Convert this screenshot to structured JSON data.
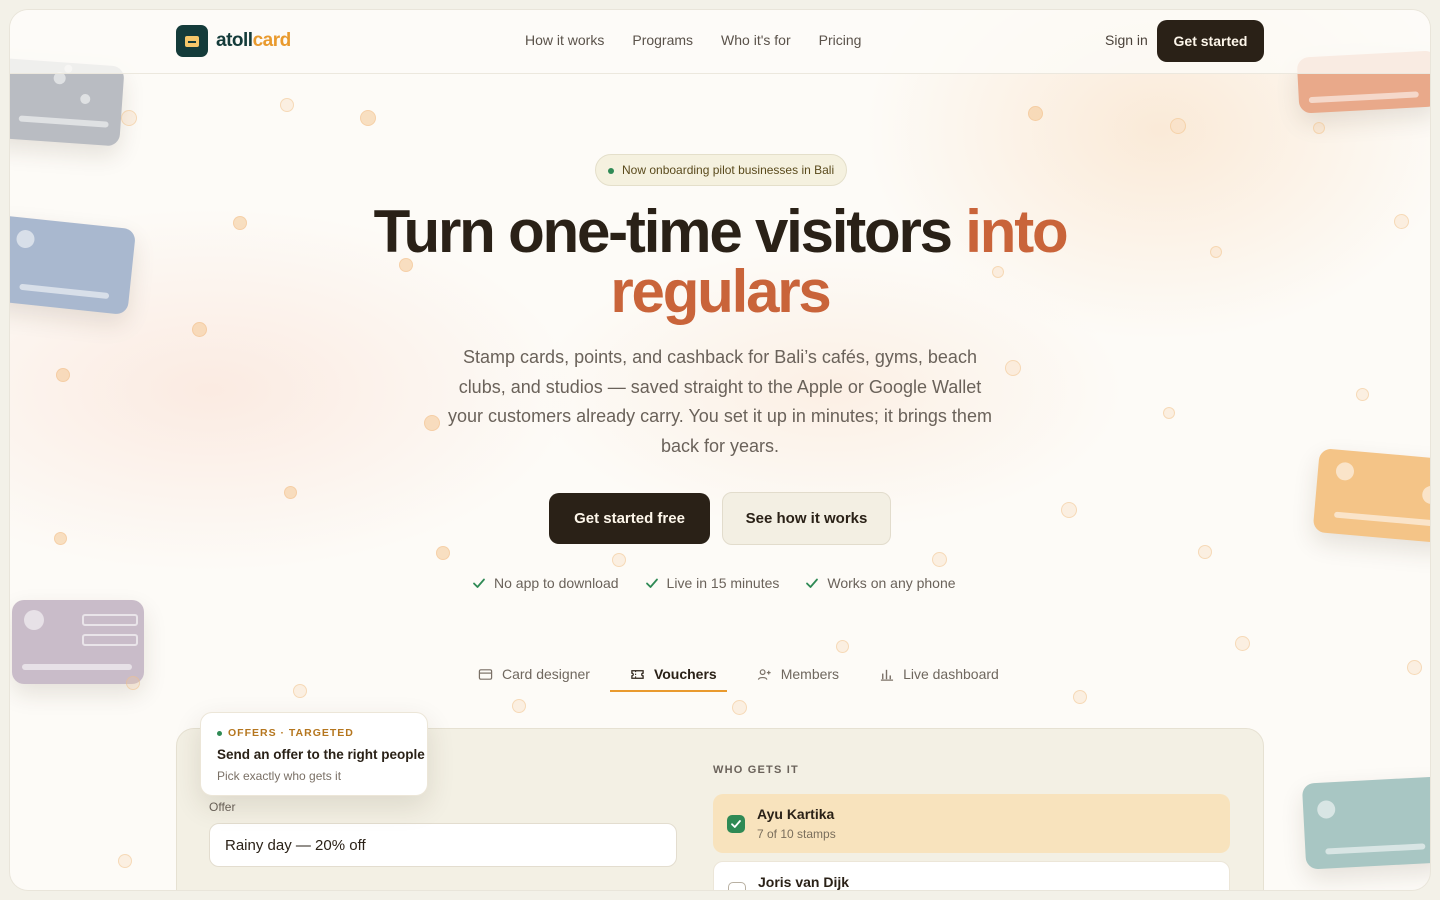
{
  "header": {
    "logo_a": "atoll",
    "logo_b": "card",
    "nav": [
      "How it works",
      "Programs",
      "Who it's for",
      "Pricing"
    ],
    "signin": "Sign in",
    "cta": "Get started"
  },
  "hero": {
    "pill": "Now onboarding pilot businesses in Bali",
    "title_main": "Turn one-time visitors ",
    "title_accent_1": "into",
    "title_accent_2": "regulars",
    "subtitle": "Stamp cards, points, and cashback for Bali’s cafés, gyms, beach clubs, and studios — saved straight to the Apple or Google Wallet your customers already carry. You set it up in minutes; it brings them back for years.",
    "primary_cta": "Get started free",
    "secondary_cta": "See how it works",
    "checks": [
      "No app to download",
      "Live in 15 minutes",
      "Works on any phone"
    ]
  },
  "tabs": [
    {
      "label": "Card designer",
      "icon": "card-icon"
    },
    {
      "label": "Vouchers",
      "icon": "ticket-icon",
      "active": true
    },
    {
      "label": "Members",
      "icon": "user-plus-icon"
    },
    {
      "label": "Live dashboard",
      "icon": "bar-chart-icon"
    }
  ],
  "demo": {
    "float_tag": "OFFERS · TARGETED",
    "float_title": "Send an offer to the right people",
    "float_sub": "Pick exactly who gets it",
    "offer_label": "Offer",
    "offer_value": "Rainy day — 20% off",
    "who_label": "WHO GETS IT",
    "members": [
      {
        "name": "Ayu Kartika",
        "detail": "7 of 10 stamps",
        "selected": true
      },
      {
        "name": "Joris van Dijk",
        "detail": "",
        "selected": false
      }
    ]
  },
  "colors": {
    "accent": "#c9643a",
    "dark": "#2a2117",
    "brand_gold": "#e99a2e",
    "success": "#2f8a55"
  }
}
